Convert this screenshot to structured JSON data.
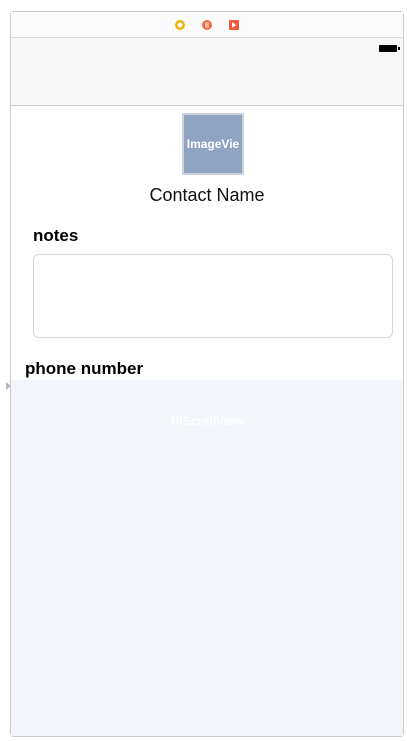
{
  "storyboard": {
    "image_view_label": "ImageVie",
    "contact_name": "Contact Name",
    "notes_label": "notes",
    "phone_label": "phone number",
    "scroll_view_label": "UIScrollView"
  },
  "dock": {
    "icons": [
      "view-controller-icon",
      "first-responder-icon",
      "exit-icon"
    ],
    "colors": {
      "view_controller": "#f0b400",
      "first_responder": "#ef6b3f",
      "exit": "#ef5a3c"
    }
  },
  "colors": {
    "image_view_fill": "#8ea4c0",
    "scroll_view_fill": "#f2f5fa",
    "navbar_fill": "#f7f7f7"
  }
}
